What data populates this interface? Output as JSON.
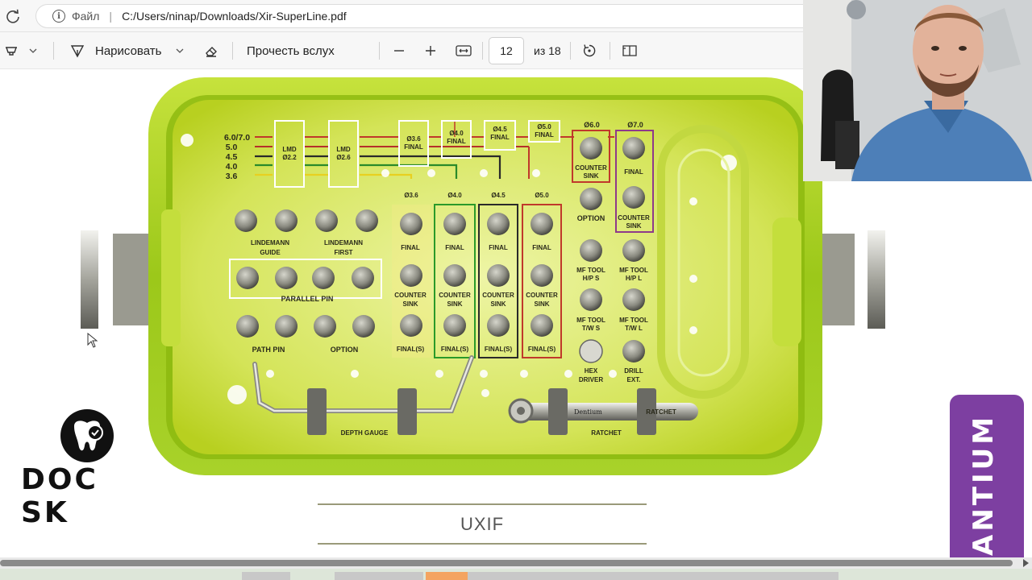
{
  "browser": {
    "scheme_label": "Файл",
    "path": "C:/Users/ninap/Downloads/Xir-SuperLine.pdf"
  },
  "toolbar": {
    "draw_label": "Нарисовать",
    "read_aloud_label": "Прочесть вслух",
    "page_current": "12",
    "page_total": "из 18"
  },
  "kit": {
    "legend": [
      "6.0/7.0",
      "5.0",
      "4.5",
      "4.0",
      "3.6"
    ],
    "lmd": [
      {
        "line1": "LMD",
        "line2": "Ø2.2"
      },
      {
        "line1": "LMD",
        "line2": "Ø2.6"
      }
    ],
    "top_finals": [
      {
        "line1": "Ø3.6",
        "line2": "FINAL"
      },
      {
        "line1": "Ø4.0",
        "line2": "FINAL"
      },
      {
        "line1": "Ø4.5",
        "line2": "FINAL"
      },
      {
        "line1": "Ø5.0",
        "line2": "FINAL"
      }
    ],
    "d60": "Ø6.0",
    "d70": "Ø7.0",
    "column_heads": [
      "Ø3.6",
      "Ø4.0",
      "Ø4.5",
      "Ø5.0"
    ],
    "final": "FINAL",
    "counter_1": "COUNTER",
    "counter_2": "SINK",
    "final_s": "FINAL(S)",
    "lindemann_guide_1": "LINDEMANN",
    "lindemann_guide_2": "GUIDE",
    "lindemann_first_1": "LINDEMANN",
    "lindemann_first_2": "FIRST",
    "parallel_pin": "PARALLEL PIN",
    "path_pin": "PATH PIN",
    "option": "OPTION",
    "option_right": "OPTION",
    "mf_hps_1": "MF TOOL",
    "mf_hps_2": "H/P S",
    "mf_hpl_1": "MF TOOL",
    "mf_hpl_2": "H/P L",
    "mf_tws_1": "MF TOOL",
    "mf_tws_2": "T/W S",
    "mf_twl_1": "MF TOOL",
    "mf_twl_2": "T/W L",
    "hex_1": "HEX",
    "hex_2": "DRIVER",
    "drill_1": "DRILL",
    "drill_2": "EXT.",
    "depth_gauge": "DEPTH GAUGE",
    "ratchet": "RATCHET",
    "ratchet_engraving": "RATCHET",
    "dentium_engraving": "Dentium"
  },
  "brand_logo": "DOC SK",
  "page_footer": "UXIF",
  "side_brand": "ANTIUM"
}
